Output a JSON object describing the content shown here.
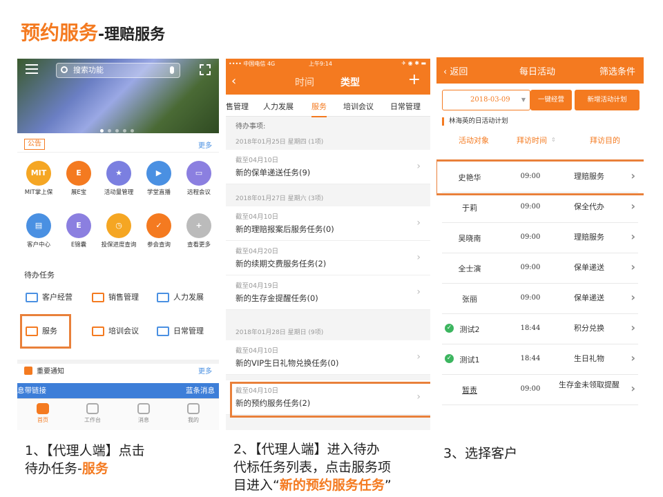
{
  "slide": {
    "title": "预约服务",
    "subtitle": "-理赔服务"
  },
  "colors": {
    "accent": "#f47a20",
    "link": "#4a90e2",
    "check": "#3cb55f",
    "highlight_box": "#e9803a"
  },
  "phone1": {
    "search_placeholder": "搜索功能",
    "announcement_tag": "公告",
    "more": "更多",
    "icons": [
      {
        "label": "MIT掌上保",
        "text": "MIT",
        "color": "#f5a623",
        "icon": "mit-icon"
      },
      {
        "label": "展E宝",
        "text": "E",
        "color": "#f47a20",
        "icon": "e-icon"
      },
      {
        "label": "活动量管理",
        "text": "★",
        "color": "#7b7fe0",
        "icon": "star-icon"
      },
      {
        "label": "学堂直播",
        "text": "▶",
        "color": "#4a90e2",
        "icon": "video-icon"
      },
      {
        "label": "远程会议",
        "text": "▭",
        "color": "#8b7fe0",
        "icon": "meeting-icon"
      },
      {
        "label": "客户中心",
        "text": "▤",
        "color": "#4a90e2",
        "icon": "customer-icon"
      },
      {
        "label": "E锦囊",
        "text": "E",
        "color": "#8b7fe0",
        "icon": "bag-icon"
      },
      {
        "label": "投保进度查询",
        "text": "◷",
        "color": "#f5a623",
        "icon": "clock-icon"
      },
      {
        "label": "参会查询",
        "text": "✓",
        "color": "#f47a20",
        "icon": "calendar-icon"
      },
      {
        "label": "查看更多",
        "text": "+",
        "color": "#bbbbbb",
        "icon": "plus-icon"
      }
    ],
    "todo_title": "待办任务",
    "tasks": [
      "客户经营",
      "销售管理",
      "人力发展",
      "服务",
      "培训会议",
      "日常管理"
    ],
    "notice": "重要通知",
    "bar_left": "息带链接",
    "bar_right": "蓝条消息",
    "tabs": [
      "首页",
      "工作台",
      "消息",
      "我的"
    ]
  },
  "phone2": {
    "carrier": "•••• 中国电信 4G",
    "time": "上午9:14",
    "battery": "✈ ◉ ✱ ▬",
    "nav": {
      "tab1": "时间",
      "tab2": "类型",
      "back": "‹",
      "plus": "+"
    },
    "tabs": [
      "售管理",
      "人力发展",
      "服务",
      "培训会议",
      "日常管理"
    ],
    "section_head": "待办事项:",
    "sections": [
      {
        "date": "2018年01月25日 星期四 (1项)"
      },
      {
        "date": "2018年01月27日 星期六 (3项)"
      },
      {
        "date": "2018年01月28日 星期日 (9项)"
      }
    ],
    "items": [
      {
        "deadline": "截至04月10日",
        "name": "新的保单递送任务(9)"
      },
      {
        "deadline": "截至04月10日",
        "name": "新的理赔报案后服务任务(0)"
      },
      {
        "deadline": "截至04月20日",
        "name": "新的续期交费服务任务(2)"
      },
      {
        "deadline": "截至04月19日",
        "name": "新的生存金提醒任务(0)"
      },
      {
        "deadline": "截至04月10日",
        "name": "新的VIP生日礼物兑换任务(0)"
      },
      {
        "deadline": "截至04月10日",
        "name": "新的预约服务任务(2)"
      }
    ]
  },
  "phone3": {
    "back": "返回",
    "title": "每日活动",
    "filter": "筛选条件",
    "date": "2018-03-09",
    "btn1": "一键经营",
    "btn2": "新增活动计划",
    "plan_title": "林海英的日活动计划",
    "cols": [
      "活动对象",
      "拜访时间",
      "拜访目的"
    ],
    "rows": [
      {
        "name": "史艳华",
        "time": "09:00",
        "purpose": "理赔服务",
        "checked": false
      },
      {
        "name": "于莉",
        "time": "09:00",
        "purpose": "保全代办",
        "checked": false
      },
      {
        "name": "吴晓南",
        "time": "09:00",
        "purpose": "理赔服务",
        "checked": false
      },
      {
        "name": "全士演",
        "time": "09:00",
        "purpose": "保单递送",
        "checked": false
      },
      {
        "name": "张丽",
        "time": "09:00",
        "purpose": "保单递送",
        "checked": false
      },
      {
        "name": "测试2",
        "time": "18:44",
        "purpose": "积分兑换",
        "checked": true
      },
      {
        "name": "测试1",
        "time": "18:44",
        "purpose": "生日礼物",
        "checked": true
      },
      {
        "name": "暂责",
        "time": "09:00",
        "purpose": "生存金未领取提醒",
        "checked": false
      }
    ]
  },
  "captions": {
    "c1_line1": "1、【代理人端】点击",
    "c1_line2a": "待办任务-",
    "c1_line2b": "服务",
    "c2_line1": "2、【代理人端】进入待办",
    "c2_line2": "代标任务列表，点击服务项",
    "c2_line3a": "目进入“",
    "c2_line3b": "新的预约服务任务",
    "c2_line3c": "”",
    "c3": "3、选择客户"
  }
}
